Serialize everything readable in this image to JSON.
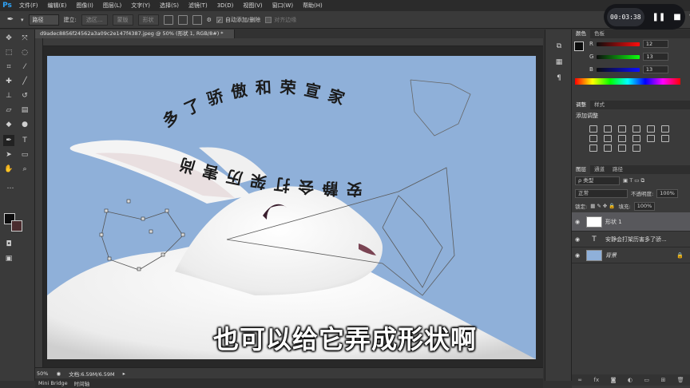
{
  "menubar": {
    "logo": "Ps",
    "items": [
      "文件(F)",
      "编辑(E)",
      "图像(I)",
      "图层(L)",
      "文字(Y)",
      "选择(S)",
      "滤镜(T)",
      "3D(D)",
      "视图(V)",
      "窗口(W)",
      "帮助(H)"
    ]
  },
  "options": {
    "mode": "路径",
    "build_label": "建立:",
    "selection_btn": "选区...",
    "mask_btn": "蒙版",
    "shape_btn": "形状",
    "auto_add_delete": "自动添加/删除",
    "align_edges": "对齐边缘"
  },
  "recorder": {
    "time": "00:03:38"
  },
  "document": {
    "tab_title": "d9adec8856f24562a3a09c2e147f4387.jpeg @ 50% (形状 1, RGB/8#) *",
    "zoom": "50%",
    "doc_size": "文档:6.59M/6.59M"
  },
  "bottom_tabs": [
    "Mini Bridge",
    "时间轴"
  ],
  "subtitle": "也可以给它弄成形状啊",
  "canvas_text": {
    "upper_arc": "多了骄傲和荣宣家",
    "lower_arc": "安静会打架历害尚"
  },
  "color_panel": {
    "tabs": [
      "颜色",
      "色板"
    ],
    "channels": [
      {
        "label": "R",
        "value": "12"
      },
      {
        "label": "G",
        "value": "13"
      },
      {
        "label": "B",
        "value": "13"
      }
    ]
  },
  "adjust_panel": {
    "tabs": [
      "调整",
      "样式"
    ],
    "title": "添加调整"
  },
  "layers_panel": {
    "tabs": [
      "图层",
      "通道",
      "路径"
    ],
    "kind": "ρ 类型",
    "blend": "正常",
    "opacity_label": "不透明度:",
    "opacity": "100%",
    "lock_label": "锁定:",
    "fill_label": "填充:",
    "fill": "100%",
    "layers": [
      {
        "name": "形状 1",
        "type": "shape",
        "selected": true
      },
      {
        "name": "安静会打架历害多了骄...",
        "type": "text",
        "selected": false
      },
      {
        "name": "背景",
        "type": "image",
        "selected": false
      }
    ]
  },
  "colors": {
    "canvas_bg": "#8fb0d9",
    "accent_blue": "#2fa3f7"
  }
}
